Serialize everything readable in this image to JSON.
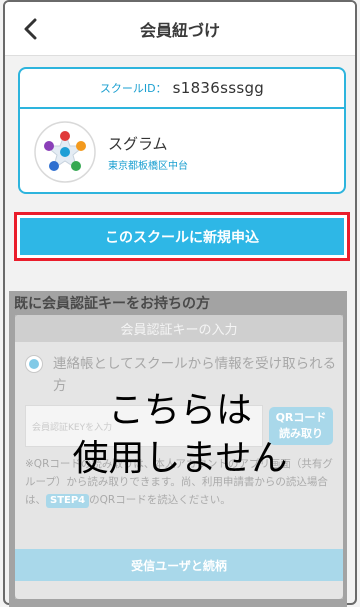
{
  "header": {
    "title": "会員紐づけ",
    "back_icon": "chevron-left-icon"
  },
  "school": {
    "id_label": "スクールID：",
    "id_value": "s1836sssgg",
    "name": "スグラム",
    "address": "東京都板橋区中台",
    "logo_icon": "school-logo-icon"
  },
  "apply_button": {
    "label": "このスクールに新規申込"
  },
  "existing": {
    "title": "既に会員認証キーをお持ちの方",
    "card_header": "会員認証キーの入力",
    "radio_label": "連絡帳としてスクールから情報を受け取られる方",
    "input_placeholder": "会員認証KEYを入力",
    "qr_button_line1": "QRコード",
    "qr_button_line2": "読み取り",
    "note_part1": "※QRコードの読み取りは、本人アカウントのアプリ画面（共有グループ）から読み取りできます。尚、利用申請書からの読込場合は、",
    "note_step": "STEP4",
    "note_part2": "のQRコードを読込ください。",
    "confirm_label": "受信ユーザと続柄"
  },
  "overlay": {
    "line1": "こちらは",
    "line2": "使用しません"
  },
  "colors": {
    "accent": "#2db4dd",
    "highlight": "#ea1d2b",
    "apply_bg": "#2eb7e6"
  }
}
